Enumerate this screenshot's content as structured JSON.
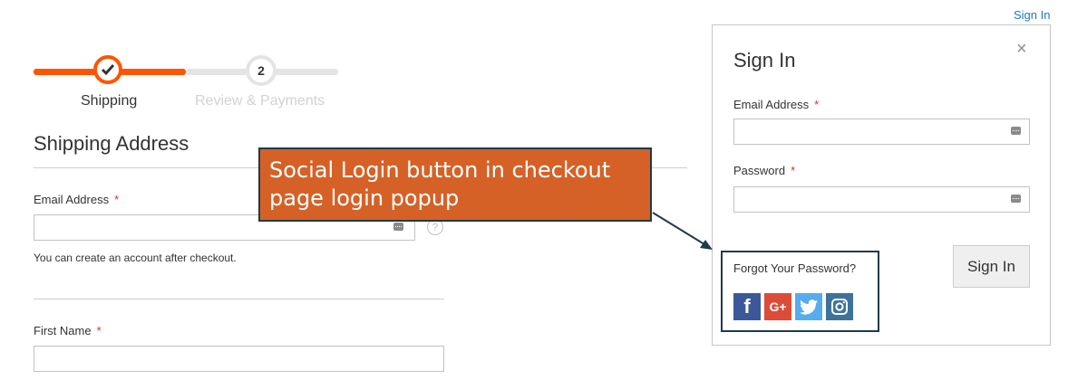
{
  "header": {
    "signin_link": "Sign In"
  },
  "progress": {
    "steps": [
      {
        "label": "Shipping",
        "state": "complete"
      },
      {
        "number": "2",
        "label": "Review & Payments",
        "state": "upcoming"
      }
    ],
    "accent_color": "#ff5501"
  },
  "shipping": {
    "title": "Shipping Address",
    "email_label": "Email Address",
    "required_mark": "*",
    "email_value": "",
    "help_icon_text": "?",
    "account_note": "You can create an account after checkout.",
    "first_name_label": "First Name",
    "first_name_value": ""
  },
  "modal": {
    "title": "Sign In",
    "close_glyph": "×",
    "email_label": "Email Address",
    "email_value": "",
    "password_label": "Password",
    "password_value": "",
    "forgot_link": "Forgot Your Password?",
    "signin_button": "Sign In",
    "social_buttons": [
      {
        "name": "facebook",
        "icon": "facebook-icon",
        "glyph": "f",
        "color": "#3b5998"
      },
      {
        "name": "google-plus",
        "icon": "google-plus-icon",
        "glyph": "G+",
        "color": "#dd4b39"
      },
      {
        "name": "twitter",
        "icon": "twitter-icon",
        "color": "#55acee"
      },
      {
        "name": "instagram",
        "icon": "instagram-icon",
        "color": "#3f729b"
      }
    ]
  },
  "callout": {
    "text": "Social Login button in checkout page login popup",
    "line1": "Social Login button in checkout",
    "line2": "page login popup",
    "color": "#d66126"
  }
}
